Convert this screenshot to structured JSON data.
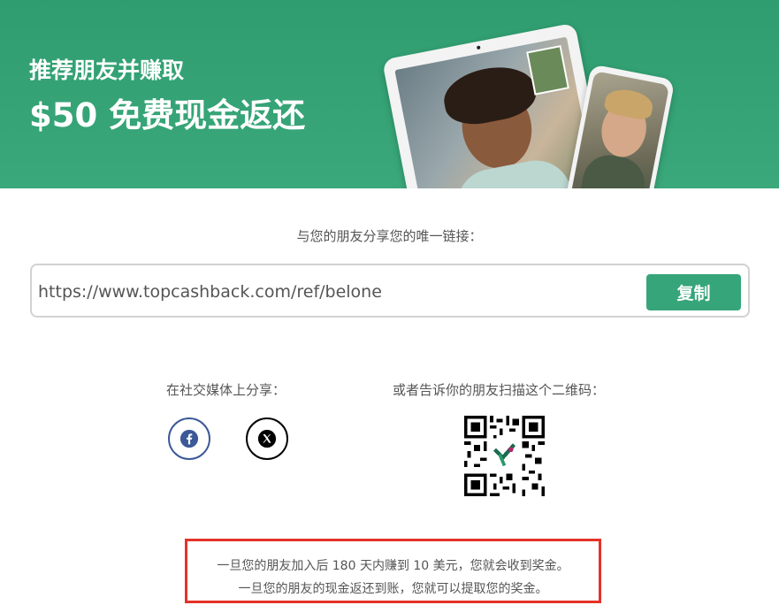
{
  "banner": {
    "subtitle": "推荐朋友并赚取",
    "title": "$50 免费现金返还"
  },
  "share": {
    "label": "与您的朋友分享您的唯一链接：",
    "url": "https://www.topcashback.com/ref/belone",
    "copy_label": "复制"
  },
  "social": {
    "label": "在社交媒体上分享：",
    "items": [
      {
        "icon": "facebook-icon",
        "color": "#3b5998"
      },
      {
        "icon": "x-twitter-icon",
        "color": "#000000"
      }
    ]
  },
  "qr": {
    "label": "或者告诉你的朋友扫描这个二维码："
  },
  "bonus": {
    "line1": "一旦您的朋友加入后 180 天内赚到 10 美元，您就会收到奖金。",
    "line2": "一旦您的朋友的现金返还到账，您就可以提取您的奖金。"
  },
  "colors": {
    "brand_green": "#36a57a",
    "highlight_red": "#e53228"
  }
}
